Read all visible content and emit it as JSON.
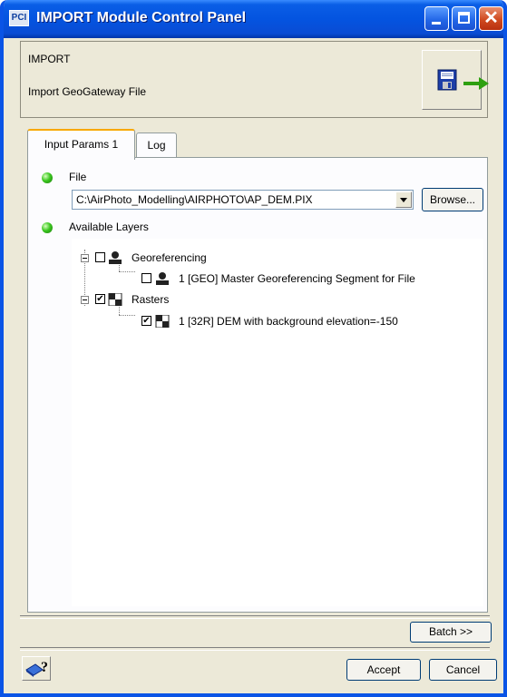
{
  "window": {
    "title": "IMPORT Module Control Panel",
    "app_icon_text": "PCI"
  },
  "header": {
    "module_name": "IMPORT",
    "description": "Import GeoGateway File"
  },
  "tabs": [
    {
      "label": "Input Params 1",
      "active": true
    },
    {
      "label": "Log",
      "active": false
    }
  ],
  "file": {
    "label": "File",
    "value": "C:\\AirPhoto_Modelling\\AIRPHOTO\\AP_DEM.PIX",
    "browse_label": "Browse..."
  },
  "layers": {
    "label": "Available Layers",
    "tree": [
      {
        "label": "Georeferencing",
        "checked": false,
        "expanded": true,
        "children": [
          {
            "label": "1 [GEO] Master Georeferencing Segment for File",
            "checked": false
          }
        ]
      },
      {
        "label": "Rasters",
        "checked": true,
        "expanded": true,
        "children": [
          {
            "label": "1 [32R] DEM with background elevation=-150",
            "checked": true
          }
        ]
      }
    ]
  },
  "buttons": {
    "batch": "Batch >>",
    "accept": "Accept",
    "cancel": "Cancel",
    "help_glyph": "?"
  },
  "colors": {
    "titlebar": "#0454e0",
    "led": "#3cc820",
    "tab_highlight": "#f8a800"
  }
}
